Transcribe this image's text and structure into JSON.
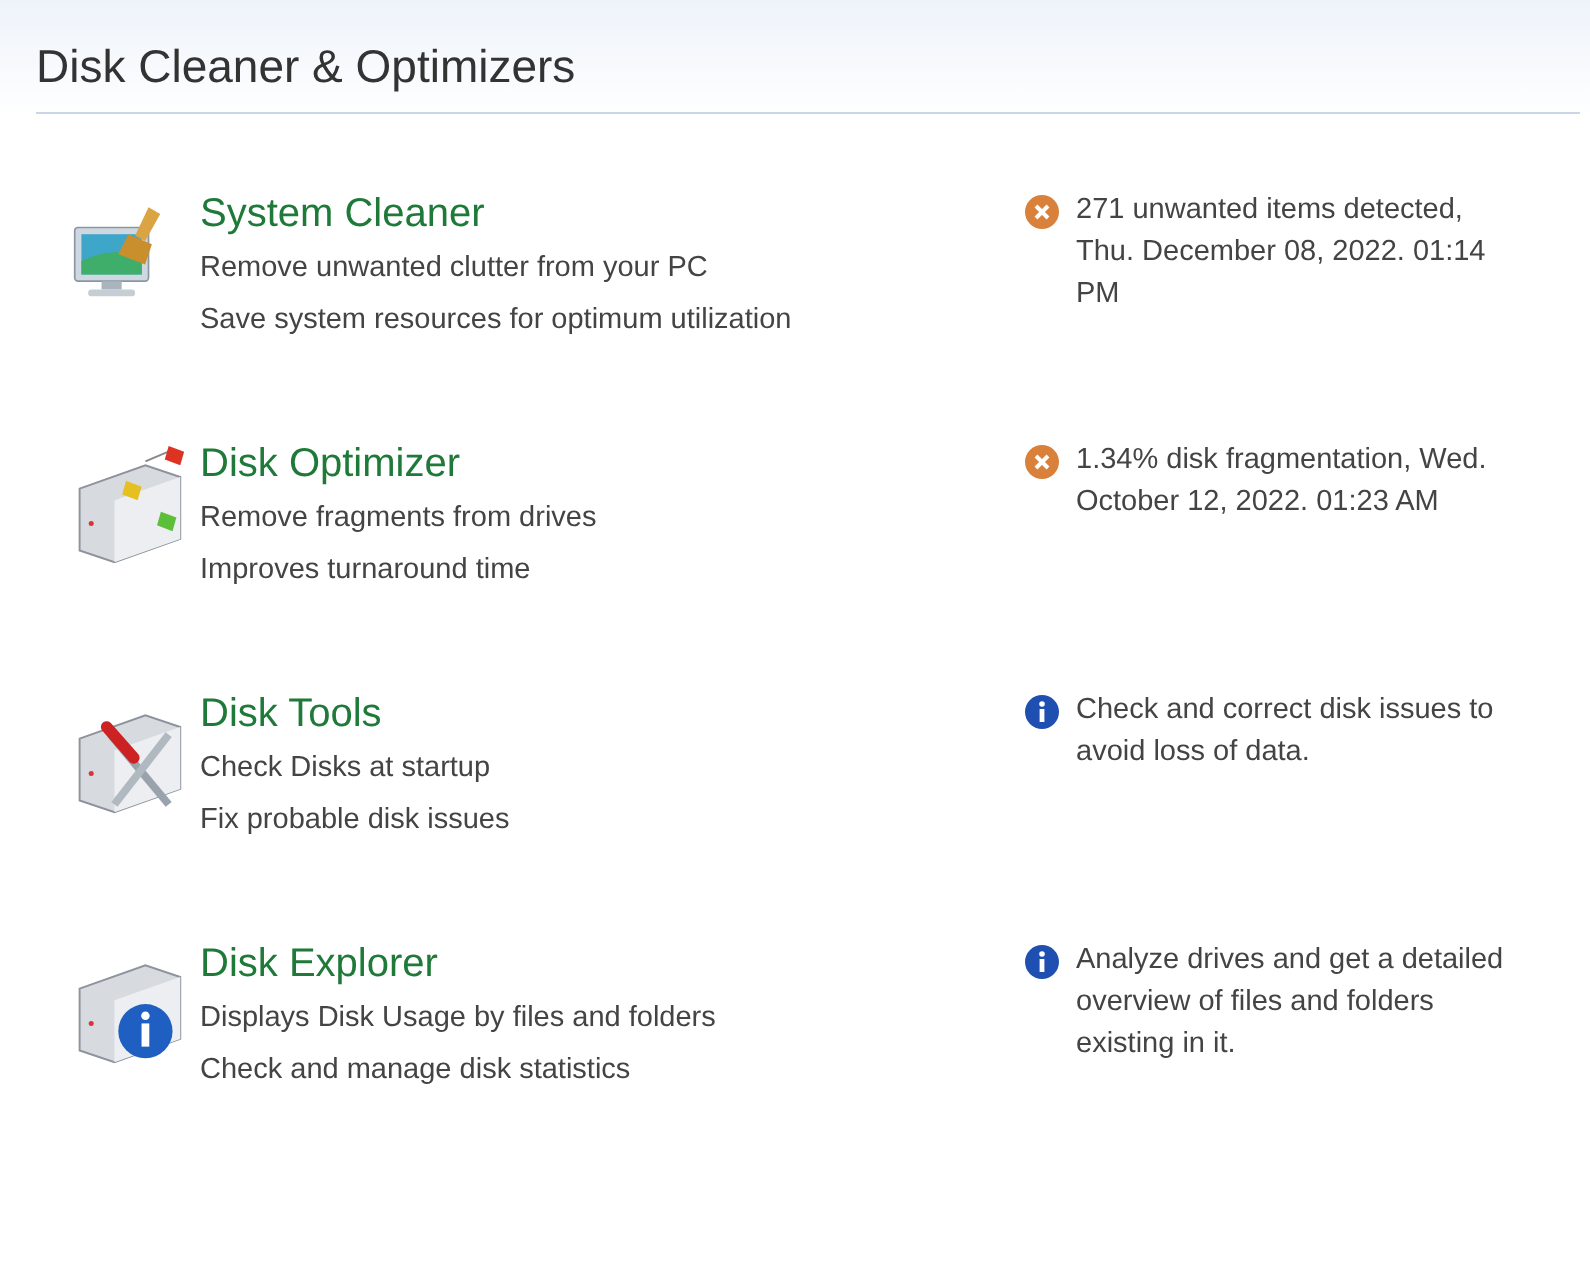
{
  "header": {
    "title": "Disk Cleaner & Optimizers"
  },
  "tools": [
    {
      "kind": "cleaner",
      "title": "System Cleaner",
      "lines": [
        "Remove unwanted clutter from your PC",
        "Save system resources for optimum utilization"
      ],
      "status": {
        "kind": "warning",
        "text": "271 unwanted items detected, Thu. December 08, 2022. 01:14 PM"
      }
    },
    {
      "kind": "optimizer",
      "title": "Disk Optimizer",
      "lines": [
        "Remove fragments from drives",
        "Improves turnaround time"
      ],
      "status": {
        "kind": "warning",
        "text": "1.34% disk fragmentation, Wed. October 12, 2022. 01:23 AM"
      }
    },
    {
      "kind": "tools",
      "title": "Disk Tools",
      "lines": [
        "Check Disks at startup",
        "Fix probable disk issues"
      ],
      "status": {
        "kind": "info",
        "text": "Check and correct disk issues to avoid loss of data."
      }
    },
    {
      "kind": "explorer",
      "title": "Disk Explorer",
      "lines": [
        "Displays Disk Usage by files and folders",
        "Check and manage disk statistics"
      ],
      "status": {
        "kind": "info",
        "text": "Analyze drives and get a detailed overview of files and folders existing in it."
      }
    }
  ]
}
